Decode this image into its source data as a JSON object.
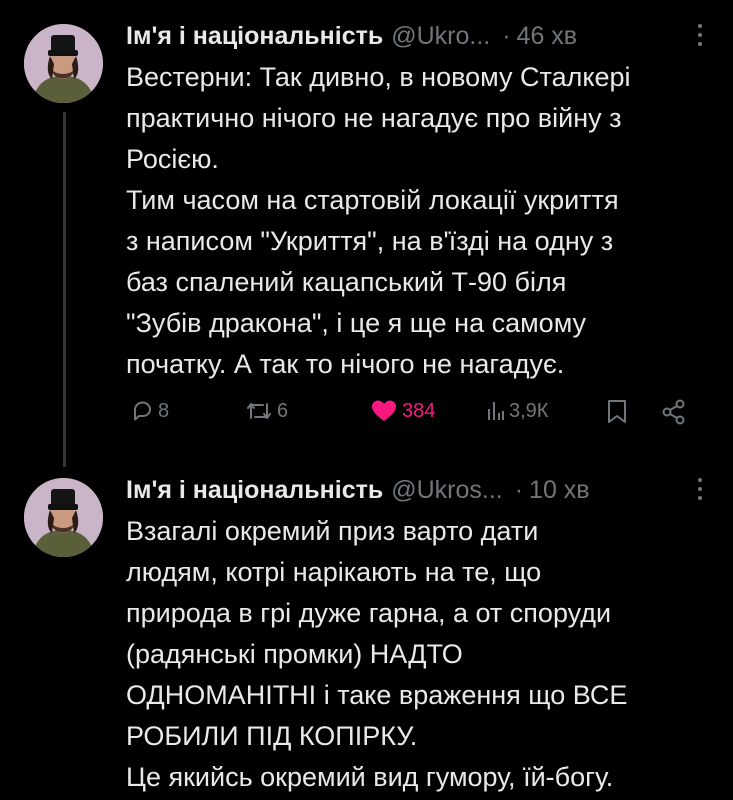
{
  "tweets": [
    {
      "author_name": "Ім'я і національність",
      "handle": "@Ukro...",
      "dot": "·",
      "time": "46 хв",
      "text": "Вестерни: Так дивно, в новому Сталкері\nпрактично нічого не нагадує про війну з\nРосією.\nТим часом на стартовій локації укриття\nз написом \"Укриття\", на в'їзді на одну з\nбаз спалений кацапський Т-90 біля\n\"Зубів дракона\", і це я ще на самому\nпочатку. А так то нічого не нагадує.",
      "replies": "8",
      "retweets": "6",
      "likes": "384",
      "views": "3,9К",
      "liked": true
    },
    {
      "author_name": "Ім'я і національність",
      "handle": "@Ukros...",
      "dot": "·",
      "time": "10 хв",
      "text": "Взагалі окремий приз варто дати\nлюдям, котрі нарікають на те, що\nприрода в грі дуже гарна, а от споруди\n(радянські промки) НАДТО\nОДНОМАНІТНІ і таке враження що ВСЕ\nРОБИЛИ ПІД КОПІРКУ.\nЦе якийсь окремий вид гумору, їй-богу."
    }
  ],
  "colors": {
    "background": "#000000",
    "text": "#e7e9ea",
    "muted": "#71767b",
    "like": "#f91880",
    "thread_line": "#333639"
  },
  "icons": [
    "reply-icon",
    "retweet-icon",
    "like-icon",
    "views-icon",
    "bookmark-icon",
    "share-icon",
    "more-icon"
  ]
}
